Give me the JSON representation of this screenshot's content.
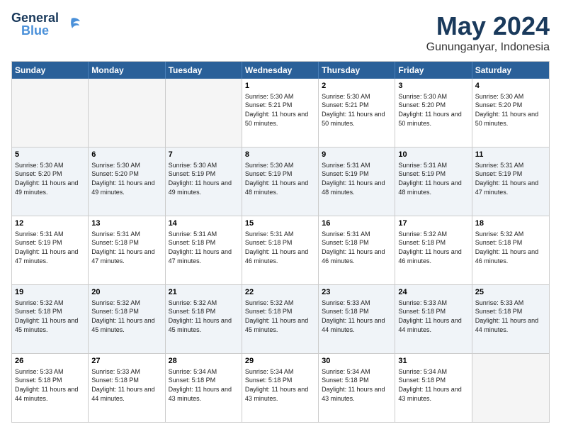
{
  "header": {
    "logo_general": "General",
    "logo_blue": "Blue",
    "month": "May 2024",
    "location": "Gununganyar, Indonesia"
  },
  "weekdays": [
    "Sunday",
    "Monday",
    "Tuesday",
    "Wednesday",
    "Thursday",
    "Friday",
    "Saturday"
  ],
  "rows": [
    [
      {
        "day": "",
        "empty": true
      },
      {
        "day": "",
        "empty": true
      },
      {
        "day": "",
        "empty": true
      },
      {
        "day": "1",
        "sunrise": "5:30 AM",
        "sunset": "5:21 PM",
        "daylight": "11 hours and 50 minutes."
      },
      {
        "day": "2",
        "sunrise": "5:30 AM",
        "sunset": "5:21 PM",
        "daylight": "11 hours and 50 minutes."
      },
      {
        "day": "3",
        "sunrise": "5:30 AM",
        "sunset": "5:20 PM",
        "daylight": "11 hours and 50 minutes."
      },
      {
        "day": "4",
        "sunrise": "5:30 AM",
        "sunset": "5:20 PM",
        "daylight": "11 hours and 50 minutes."
      }
    ],
    [
      {
        "day": "5",
        "sunrise": "5:30 AM",
        "sunset": "5:20 PM",
        "daylight": "11 hours and 49 minutes."
      },
      {
        "day": "6",
        "sunrise": "5:30 AM",
        "sunset": "5:20 PM",
        "daylight": "11 hours and 49 minutes."
      },
      {
        "day": "7",
        "sunrise": "5:30 AM",
        "sunset": "5:19 PM",
        "daylight": "11 hours and 49 minutes."
      },
      {
        "day": "8",
        "sunrise": "5:30 AM",
        "sunset": "5:19 PM",
        "daylight": "11 hours and 48 minutes."
      },
      {
        "day": "9",
        "sunrise": "5:31 AM",
        "sunset": "5:19 PM",
        "daylight": "11 hours and 48 minutes."
      },
      {
        "day": "10",
        "sunrise": "5:31 AM",
        "sunset": "5:19 PM",
        "daylight": "11 hours and 48 minutes."
      },
      {
        "day": "11",
        "sunrise": "5:31 AM",
        "sunset": "5:19 PM",
        "daylight": "11 hours and 47 minutes."
      }
    ],
    [
      {
        "day": "12",
        "sunrise": "5:31 AM",
        "sunset": "5:19 PM",
        "daylight": "11 hours and 47 minutes."
      },
      {
        "day": "13",
        "sunrise": "5:31 AM",
        "sunset": "5:18 PM",
        "daylight": "11 hours and 47 minutes."
      },
      {
        "day": "14",
        "sunrise": "5:31 AM",
        "sunset": "5:18 PM",
        "daylight": "11 hours and 47 minutes."
      },
      {
        "day": "15",
        "sunrise": "5:31 AM",
        "sunset": "5:18 PM",
        "daylight": "11 hours and 46 minutes."
      },
      {
        "day": "16",
        "sunrise": "5:31 AM",
        "sunset": "5:18 PM",
        "daylight": "11 hours and 46 minutes."
      },
      {
        "day": "17",
        "sunrise": "5:32 AM",
        "sunset": "5:18 PM",
        "daylight": "11 hours and 46 minutes."
      },
      {
        "day": "18",
        "sunrise": "5:32 AM",
        "sunset": "5:18 PM",
        "daylight": "11 hours and 46 minutes."
      }
    ],
    [
      {
        "day": "19",
        "sunrise": "5:32 AM",
        "sunset": "5:18 PM",
        "daylight": "11 hours and 45 minutes."
      },
      {
        "day": "20",
        "sunrise": "5:32 AM",
        "sunset": "5:18 PM",
        "daylight": "11 hours and 45 minutes."
      },
      {
        "day": "21",
        "sunrise": "5:32 AM",
        "sunset": "5:18 PM",
        "daylight": "11 hours and 45 minutes."
      },
      {
        "day": "22",
        "sunrise": "5:32 AM",
        "sunset": "5:18 PM",
        "daylight": "11 hours and 45 minutes."
      },
      {
        "day": "23",
        "sunrise": "5:33 AM",
        "sunset": "5:18 PM",
        "daylight": "11 hours and 44 minutes."
      },
      {
        "day": "24",
        "sunrise": "5:33 AM",
        "sunset": "5:18 PM",
        "daylight": "11 hours and 44 minutes."
      },
      {
        "day": "25",
        "sunrise": "5:33 AM",
        "sunset": "5:18 PM",
        "daylight": "11 hours and 44 minutes."
      }
    ],
    [
      {
        "day": "26",
        "sunrise": "5:33 AM",
        "sunset": "5:18 PM",
        "daylight": "11 hours and 44 minutes."
      },
      {
        "day": "27",
        "sunrise": "5:33 AM",
        "sunset": "5:18 PM",
        "daylight": "11 hours and 44 minutes."
      },
      {
        "day": "28",
        "sunrise": "5:34 AM",
        "sunset": "5:18 PM",
        "daylight": "11 hours and 43 minutes."
      },
      {
        "day": "29",
        "sunrise": "5:34 AM",
        "sunset": "5:18 PM",
        "daylight": "11 hours and 43 minutes."
      },
      {
        "day": "30",
        "sunrise": "5:34 AM",
        "sunset": "5:18 PM",
        "daylight": "11 hours and 43 minutes."
      },
      {
        "day": "31",
        "sunrise": "5:34 AM",
        "sunset": "5:18 PM",
        "daylight": "11 hours and 43 minutes."
      },
      {
        "day": "",
        "empty": true
      }
    ]
  ],
  "labels": {
    "sunrise": "Sunrise:",
    "sunset": "Sunset:",
    "daylight": "Daylight:"
  }
}
